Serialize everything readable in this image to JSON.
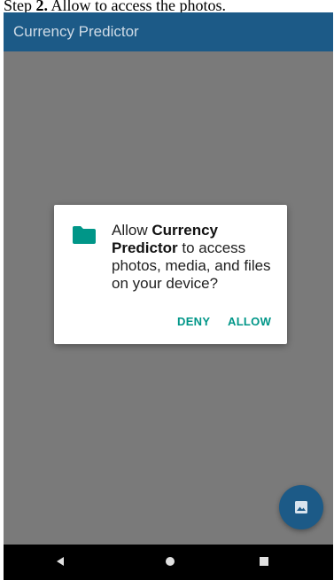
{
  "caption": {
    "prefix": "Step ",
    "number": "2.",
    "text": " Allow to access the photos."
  },
  "appbar": {
    "title": "Currency Predictor"
  },
  "dialog": {
    "icon": "folder-icon",
    "message_prefix": "Allow ",
    "app_name": "Currency Predictor",
    "message_suffix": " to access photos, media, and files on your device?",
    "deny_label": "DENY",
    "allow_label": "ALLOW"
  },
  "fab": {
    "icon": "image-icon"
  },
  "navbar": {
    "icons": [
      "back-icon",
      "home-icon",
      "recents-icon"
    ]
  },
  "colors": {
    "appbar": "#1c5a87",
    "accent": "#009688",
    "scrim": "#7a7a7a",
    "navbar": "#000000"
  }
}
